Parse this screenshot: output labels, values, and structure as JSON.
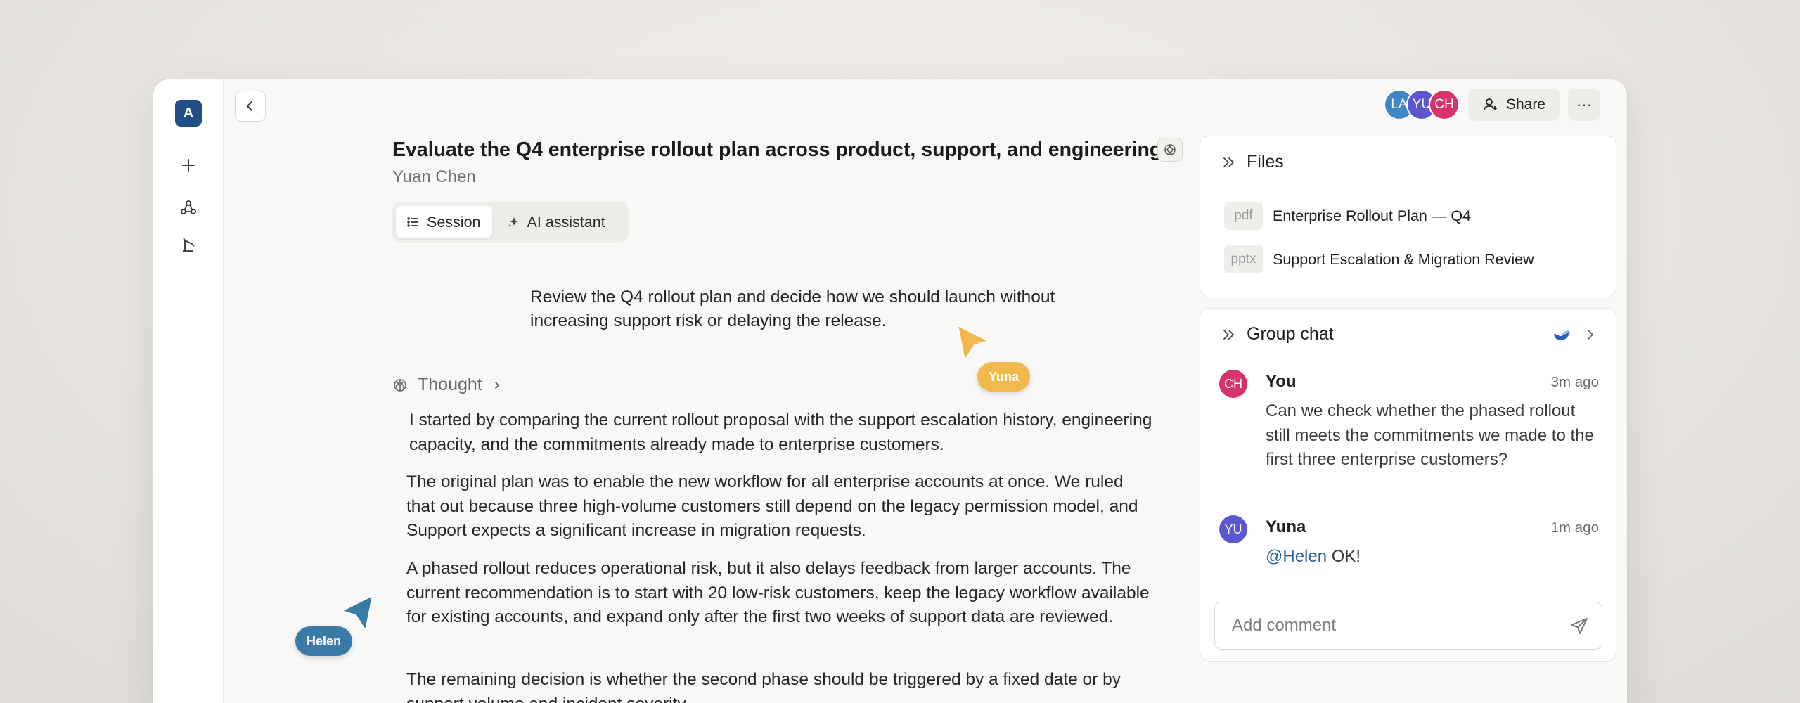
{
  "app": {
    "logo_letter": "A"
  },
  "header": {
    "avatars": [
      {
        "initials": "LA",
        "color": "#3f86c6"
      },
      {
        "initials": "YU",
        "color": "#5b57d1"
      },
      {
        "initials": "CH",
        "color": "#d6336c"
      }
    ],
    "share_label": "Share",
    "more_label": "···"
  },
  "main": {
    "title": "Evaluate the Q4 enterprise rollout plan across product, support, and engineering",
    "author": "Yuan Chen",
    "tabs": [
      {
        "label": "Session",
        "icon": "list-icon",
        "active": true
      },
      {
        "label": "AI assistant",
        "icon": "sparkle-icon",
        "active": false
      }
    ],
    "prompt": "Review the Q4 rollout plan and decide how we should launch without increasing support risk or delaying the release.",
    "thought_label": "Thought",
    "paragraphs": [
      "I started by comparing the current rollout proposal with the support escalation history, engineering capacity, and the commitments already made to enterprise customers.",
      "The original plan was to enable the new workflow for all enterprise accounts at once. We ruled that out because three high-volume customers still depend on the legacy permission model, and Support expects a significant increase in migration requests.",
      "A phased rollout reduces operational risk, but it also delays feedback from larger accounts. The current recommendation is to start with 20 low-risk customers, keep the legacy workflow available for existing accounts, and expand only after the first two weeks of support data are reviewed.",
      "The remaining decision is whether the second phase should be triggered by a fixed date or by support volume and incident severity."
    ]
  },
  "cursors": [
    {
      "name": "Yuna",
      "color": "#f2b84b"
    },
    {
      "name": "Helen",
      "color": "#3a7aa6"
    }
  ],
  "files": {
    "title": "Files",
    "items": [
      {
        "type": "pdf",
        "name": "Enterprise Rollout Plan — Q4"
      },
      {
        "type": "pptx",
        "name": "Support Escalation & Migration Review"
      }
    ]
  },
  "chat": {
    "title": "Group chat",
    "messages": [
      {
        "initials": "CH",
        "color": "#d6336c",
        "name": "You",
        "time": "3m ago",
        "text": "Can we check whether the phased rollout still meets the commitments we made to the first three enterprise customers?"
      },
      {
        "initials": "YU",
        "color": "#5b57d1",
        "name": "Yuna",
        "time": "1m ago",
        "mention": "@Helen",
        "text": " OK!"
      }
    ],
    "comment_placeholder": "Add comment"
  }
}
